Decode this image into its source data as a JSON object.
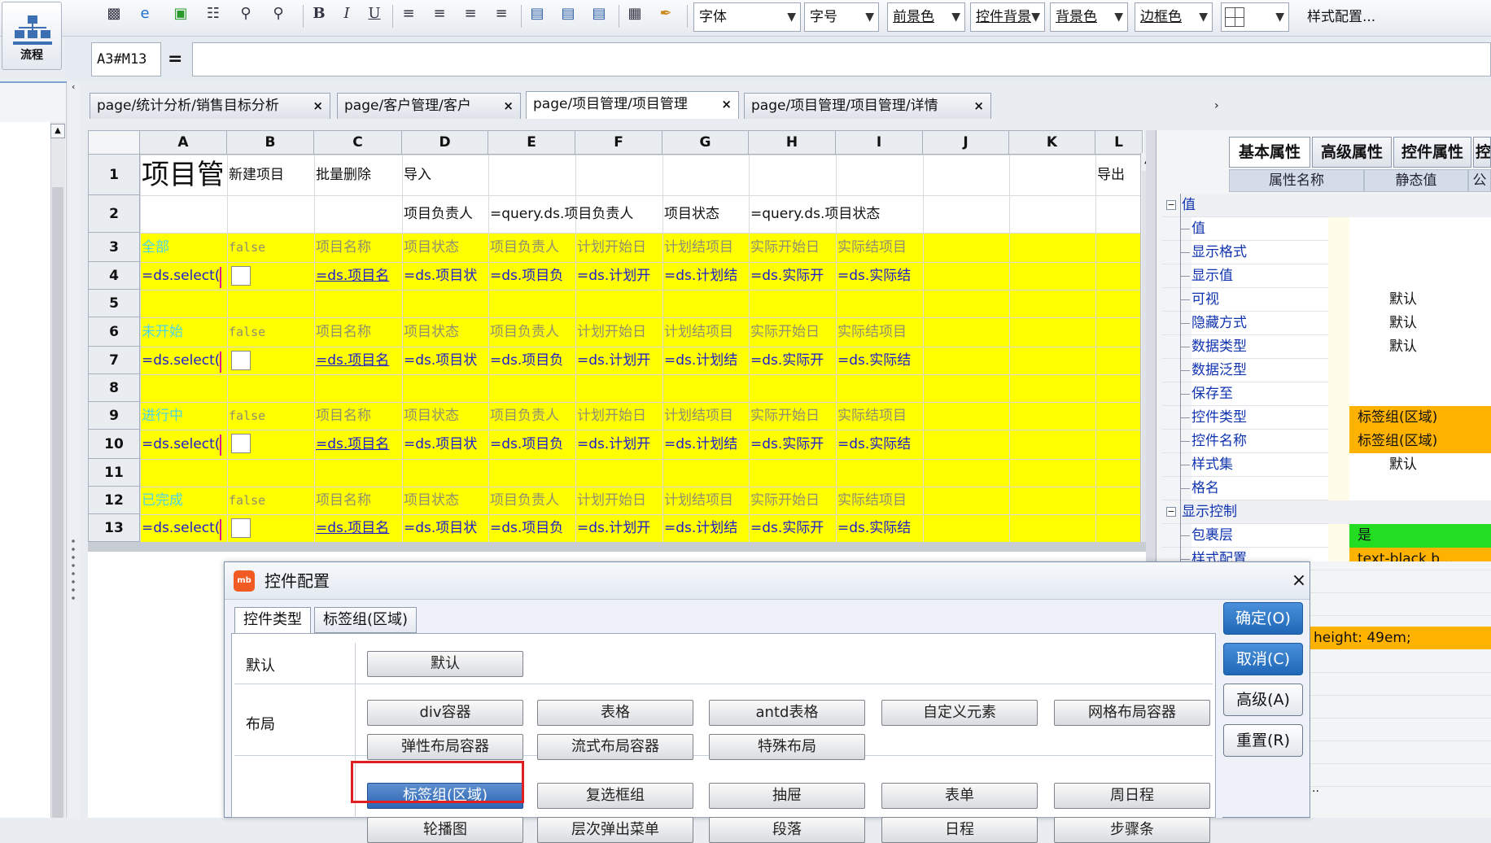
{
  "toolbar": {
    "font_select": "字体",
    "size_select": "字号",
    "fg_select": "前景色",
    "ctrl_select": "控件背景",
    "bg_select": "背景色",
    "border_select": "边框色",
    "style_config": "样式配置...",
    "icons": [
      "save-icon",
      "ie-icon",
      "preview-icon",
      "print-preview-icon",
      "find-icon",
      "binoculars-icon",
      "bold-icon",
      "italic-icon",
      "underline-icon",
      "align-left-icon",
      "align-center-icon",
      "align-right-icon",
      "justify-icon",
      "valign-top-icon",
      "valign-middle-icon",
      "valign-bottom-icon",
      "merge-icon",
      "format-brush-icon",
      "border-grid-icon"
    ]
  },
  "flow_button": {
    "label": "流程"
  },
  "formula": {
    "cell_ref": "A3#M13",
    "equals": "=",
    "value": ""
  },
  "tabs": [
    {
      "label": "page/统计分析/销售目标分析",
      "close": "×"
    },
    {
      "label": "page/客户管理/客户",
      "close": "×"
    },
    {
      "label": "page/项目管理/项目管理",
      "close": "×"
    },
    {
      "label": "page/项目管理/项目管理/详情",
      "close": "×"
    }
  ],
  "sheet": {
    "columns": [
      "A",
      "B",
      "C",
      "D",
      "E",
      "F",
      "G",
      "H",
      "I",
      "J",
      "K",
      "L"
    ],
    "rows": [
      "1",
      "2",
      "3",
      "4",
      "5",
      "6",
      "7",
      "8",
      "9",
      "10",
      "11",
      "12",
      "13"
    ],
    "r1": {
      "a": "项目管",
      "b": "新建项目",
      "c": "批量删除",
      "d": "导入",
      "l": "导出"
    },
    "r2": {
      "d": "项目负责人",
      "e": "=query.ds.项目负责人",
      "g": "项目状态",
      "h": "=query.ds.项目状态"
    },
    "groups": [
      {
        "label": "全部",
        "flag": "false"
      },
      {
        "label": "未开始",
        "flag": "false"
      },
      {
        "label": "进行中",
        "flag": "false"
      },
      {
        "label": "已完成",
        "flag": "false"
      }
    ],
    "headers": [
      "项目名称",
      "项目状态",
      "项目负责人",
      "计划开始日",
      "计划结项目",
      "实际开始日",
      "实际结项目"
    ],
    "formulas": {
      "a": "=ds.select(",
      "c": "=ds.项目名",
      "d": "=ds.项目状",
      "e": "=ds.项目负",
      "f": "=ds.计划开",
      "g": "=ds.计划结",
      "h": "=ds.实际开",
      "i": "=ds.实际结"
    }
  },
  "right_panel": {
    "tabs": [
      "基本属性",
      "高级属性",
      "控件属性",
      "控件动作"
    ],
    "columns": [
      "属性名称",
      "静态值",
      "公式"
    ],
    "props": [
      {
        "name": "值",
        "value": "",
        "group": true
      },
      {
        "name": "值",
        "value": ""
      },
      {
        "name": "显示格式",
        "value": ""
      },
      {
        "name": "显示值",
        "value": ""
      },
      {
        "name": "可视",
        "value": "默认"
      },
      {
        "name": "隐藏方式",
        "value": "默认"
      },
      {
        "name": "数据类型",
        "value": "默认"
      },
      {
        "name": "数据泛型",
        "value": ""
      },
      {
        "name": "保存至",
        "value": ""
      },
      {
        "name": "控件类型",
        "value": "标签组(区域)",
        "color": "#ffb300"
      },
      {
        "name": "控件名称",
        "value": "标签组(区域)",
        "color": "#ffb300"
      },
      {
        "name": "样式集",
        "value": "默认"
      },
      {
        "name": "格名",
        "value": ""
      },
      {
        "name": "显示控制",
        "value": "",
        "group": true
      },
      {
        "name": "包裹层",
        "value": "是",
        "color": "#22dd22"
      },
      {
        "name": "样式配置",
        "value": "text-black,b...",
        "color": "#ffb300"
      }
    ],
    "extra_value": "height: 49em;",
    "extra_dots": ".."
  },
  "dialog": {
    "title": "控件配置",
    "logo": "mb",
    "close": "×",
    "tabs": [
      "控件类型",
      "标签组(区域)"
    ],
    "sections": {
      "default_label": "默认",
      "default_options": [
        "默认"
      ],
      "layout_label": "布局",
      "layout_options_row1": [
        "div容器",
        "表格",
        "antd表格",
        "自定义元素",
        "网格布局容器"
      ],
      "layout_options_row2": [
        "弹性布局容器",
        "流式布局容器",
        "特殊布局"
      ],
      "other_options_row1": [
        "标签组(区域)",
        "复选框组",
        "抽屉",
        "表单",
        "周日程"
      ],
      "other_options_row2": [
        "轮播图",
        "层次弹出菜单",
        "段落",
        "日程",
        "步骤条"
      ]
    },
    "buttons": {
      "ok": "确定(O)",
      "cancel": "取消(C)",
      "advanced": "高级(A)",
      "reset": "重置(R)"
    }
  }
}
